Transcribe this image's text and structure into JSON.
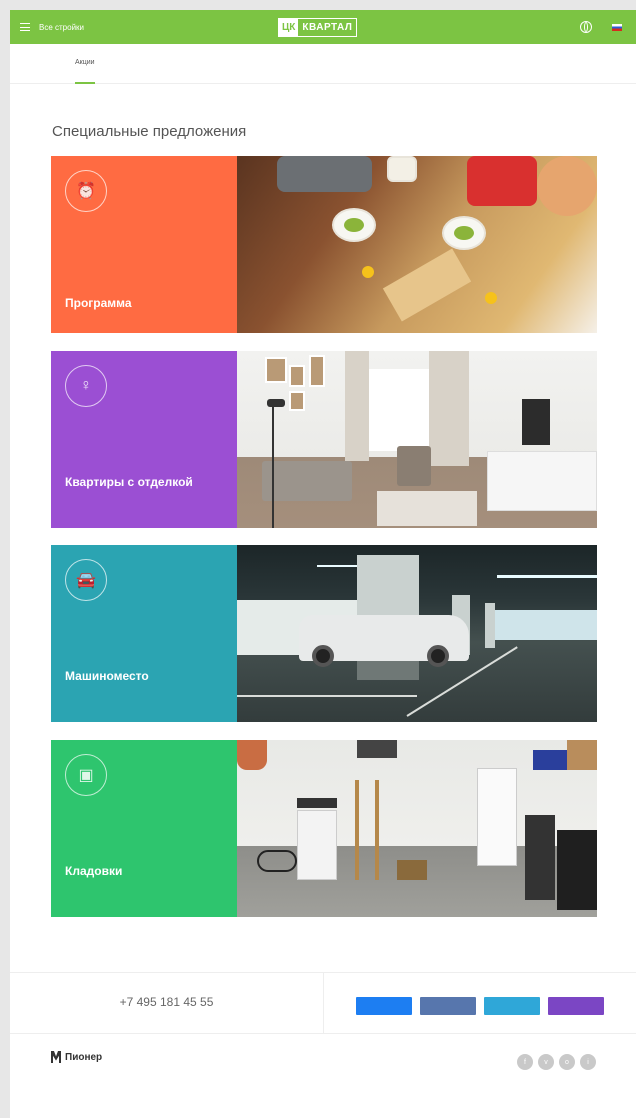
{
  "header": {
    "menu_label": "Все стройки",
    "logo_mark": "ЦК",
    "logo_name": "КВАРТАЛ",
    "phone": "",
    "lang": "",
    "colors": {
      "bar": "#7cc443"
    }
  },
  "nav": {
    "items": [
      {
        "label": ""
      },
      {
        "label": "Акции",
        "active": true
      },
      {
        "label": ""
      },
      {
        "label": ""
      },
      {
        "label": ""
      },
      {
        "label": ""
      },
      {
        "label": ""
      },
      {
        "label": ""
      }
    ]
  },
  "main": {
    "title": "Специальные предложения",
    "offers": [
      {
        "title": "Программа",
        "subtitle": "",
        "desc": "",
        "color": "#ff6b42",
        "icon": "alarm-clock-icon"
      },
      {
        "title": "Квартиры с отделкой",
        "subtitle": "",
        "desc": "",
        "color": "#9b4fd3",
        "icon": "lamp-icon"
      },
      {
        "title": "Машиноместо",
        "subtitle": "",
        "desc": "",
        "color": "#2ba4b2",
        "icon": "car-icon"
      },
      {
        "title": "Кладовки",
        "subtitle": "",
        "desc": "",
        "color": "#2ec56e",
        "icon": "box-icon"
      }
    ]
  },
  "contact": {
    "phone": "+7 495 181 45 55",
    "phone_note": "",
    "subscribe_title": "",
    "buttons": [
      {
        "label": "",
        "color": "#1d7ef2"
      },
      {
        "label": "",
        "color": "#5776ad"
      },
      {
        "label": "",
        "color": "#2fa7d8"
      },
      {
        "label": "",
        "color": "#7b46c4"
      }
    ]
  },
  "footer": {
    "logo": "Пионер",
    "col1": [
      "",
      "",
      "",
      ""
    ],
    "col2": [
      "",
      "",
      ""
    ],
    "copyright": "",
    "developer": "",
    "social": [
      "f",
      "v",
      "o",
      "i"
    ]
  }
}
